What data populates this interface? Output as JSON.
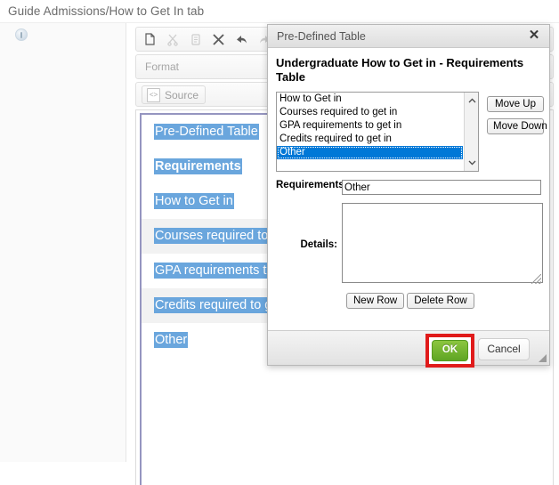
{
  "page": {
    "breadcrumb": "Guide Admissions/How to Get In tab",
    "help_icon": "help-info-icon"
  },
  "editor": {
    "toolbar": {
      "icons": [
        {
          "name": "paste-icon",
          "enabled": true
        },
        {
          "name": "cut-icon",
          "enabled": false
        },
        {
          "name": "copy-icon",
          "enabled": false
        },
        {
          "name": "paste-as-plain-text-icon",
          "enabled": true
        },
        {
          "name": "undo-icon",
          "enabled": true
        },
        {
          "name": "redo-icon",
          "enabled": false
        }
      ],
      "format_label": "Format",
      "source_label": "Source",
      "source_icon": "source-code-icon"
    },
    "document_table": {
      "rows": [
        {
          "text": "Pre-Defined Table",
          "bold": false,
          "shaded": false
        },
        {
          "text": "Requirements",
          "bold": true,
          "shaded": false
        },
        {
          "text": "How to Get in",
          "bold": false,
          "shaded": false
        },
        {
          "text": "Courses required to get in",
          "bold": false,
          "shaded": true
        },
        {
          "text": "GPA requirements to get in",
          "bold": false,
          "shaded": false
        },
        {
          "text": "Credits required to get in",
          "bold": false,
          "shaded": true
        },
        {
          "text": "Other",
          "bold": false,
          "shaded": false
        }
      ],
      "selection_color": "#6aa6dd",
      "border_color": "#9595c0"
    }
  },
  "dialog": {
    "title": "Pre-Defined Table",
    "close_icon": "close-icon",
    "heading": "Undergraduate How to Get in - Requirements Table",
    "listbox": {
      "options": [
        "How to Get in",
        "Courses required to get in",
        "GPA requirements to get in",
        "Credits required to get in",
        "Other"
      ],
      "selected_index": 4,
      "selected_color": "#0078d7",
      "scroll_up_icon": "chevron-up-icon",
      "scroll_down_icon": "chevron-down-icon"
    },
    "move_up_label": "Move Up",
    "move_down_label": "Move Down",
    "requirements_label": "Requirements:",
    "requirements_value": "Other",
    "requirements_placeholder": "",
    "details_label": "Details:",
    "details_value": "",
    "details_placeholder": "",
    "new_row_label": "New Row",
    "delete_row_label": "Delete Row",
    "ok_label": "OK",
    "cancel_label": "Cancel",
    "ok_accent_color": "#76bc21",
    "highlight_color": "#e01b1b",
    "resize_grip_icon": "resize-grip-icon"
  }
}
